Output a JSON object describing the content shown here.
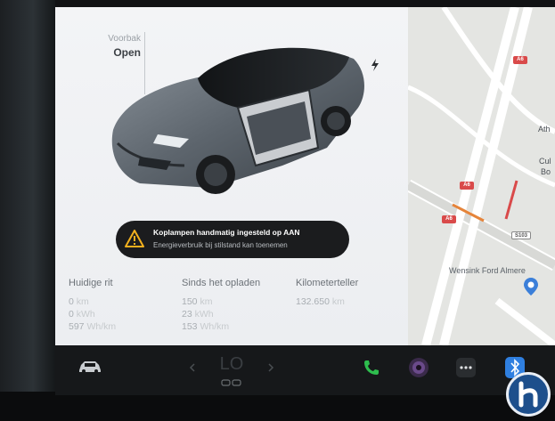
{
  "vehicle": {
    "frunk_label": "Voorbak",
    "frunk_state": "Open"
  },
  "alert": {
    "title": "Koplampen handmatig ingesteld op AAN",
    "subtitle": "Energieverbruik bij stilstand kan toenemen",
    "color": "#f2b01e"
  },
  "stats": {
    "trip": {
      "heading": "Huidige rit",
      "rows": [
        {
          "value": "0",
          "unit": "km"
        },
        {
          "value": "0",
          "unit": "kWh"
        },
        {
          "value": "597",
          "unit": "Wh/km"
        }
      ]
    },
    "since_charge": {
      "heading": "Sinds het opladen",
      "rows": [
        {
          "value": "150",
          "unit": "km"
        },
        {
          "value": "23",
          "unit": "kWh"
        },
        {
          "value": "153",
          "unit": "Wh/km"
        }
      ]
    },
    "odometer": {
      "heading": "Kilometerteller",
      "rows": [
        {
          "value": "132.650",
          "unit": "km"
        }
      ]
    }
  },
  "map": {
    "route_label_1": "A6",
    "route_label_2": "A6",
    "route_label_3": "A6",
    "route_label_4": "S103",
    "place_1": "Ath",
    "place_2": "Cul",
    "place_3": "Bo",
    "poi": "Wensink Ford Almere",
    "route_color": "#e5843a"
  },
  "dock": {
    "climate_value": "LO",
    "icons": [
      "car-icon",
      "chevron-left-icon",
      "chevron-right-icon",
      "seat-heat-icon",
      "phone-icon",
      "camera-icon",
      "more-icon",
      "bluetooth-icon"
    ],
    "phone_color": "#2ebd4e",
    "bluetooth_color": "#2f7fe0"
  }
}
